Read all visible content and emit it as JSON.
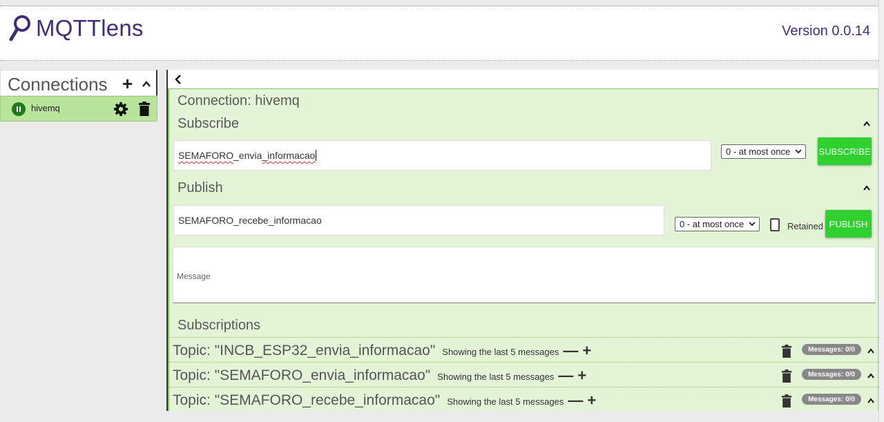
{
  "app": {
    "title": "MQTTlens",
    "version": "Version 0.0.14",
    "accent_color": "#3f2d7a"
  },
  "connections": {
    "title": "Connections",
    "add_label": "+",
    "items": [
      {
        "name": "hivemq",
        "status": "connected",
        "status_color": "#1d7a1d"
      }
    ]
  },
  "main": {
    "connection_label": "Connection: hivemq",
    "subscribe": {
      "title": "Subscribe",
      "topic_prefix": "SEMAFORO",
      "topic_mid": "_envia",
      "topic_suffix": "_informacao",
      "qos": "0 - at most once",
      "button": "SUBSCRIBE"
    },
    "publish": {
      "title": "Publish",
      "topic": "SEMAFORO_recebe_informacao",
      "qos": "0 - at most once",
      "retained_label": "Retained",
      "retained_checked": false,
      "button": "PUBLISH",
      "message_placeholder": "Message"
    },
    "subscriptions": {
      "title": "Subscriptions",
      "items": [
        {
          "topic": "Topic: \"INCB_ESP32_envia_informacao\"",
          "showing": "Showing the last 5 messages",
          "minus": "—",
          "plus": "+",
          "badge": "Messages: 0/0"
        },
        {
          "topic": "Topic: \"SEMAFORO_envia_informacao\"",
          "showing": "Showing the last 5 messages",
          "minus": "—",
          "plus": "+",
          "badge": "Messages: 0/0"
        },
        {
          "topic": "Topic: \"SEMAFORO_recebe_informacao\"",
          "showing": "Showing the last 5 messages",
          "minus": "—",
          "plus": "+",
          "badge": "Messages: 0/0"
        }
      ]
    }
  },
  "colors": {
    "panel_green": "#e3f5d6",
    "item_green": "#b9e49b",
    "button_green": "#2ed12e"
  }
}
